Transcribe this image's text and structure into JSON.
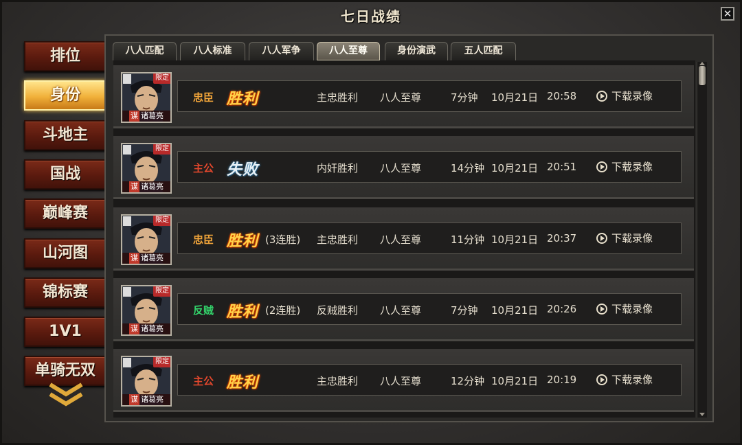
{
  "window": {
    "title": "七日战绩",
    "close_label": "✕"
  },
  "nav": {
    "items": [
      {
        "label": "排位"
      },
      {
        "label": "身份"
      },
      {
        "label": "斗地主"
      },
      {
        "label": "国战"
      },
      {
        "label": "巅峰赛"
      },
      {
        "label": "山河图"
      },
      {
        "label": "锦标赛"
      },
      {
        "label": "1V1"
      },
      {
        "label": "单骑无双"
      }
    ],
    "active_index": 1
  },
  "tabs": [
    {
      "label": "八人匹配"
    },
    {
      "label": "八人标准"
    },
    {
      "label": "八人军争"
    },
    {
      "label": "八人至尊"
    },
    {
      "label": "身份演武"
    },
    {
      "label": "五人匹配"
    }
  ],
  "active_tab_index": 3,
  "colors": {
    "loyal": "#f0a43a",
    "lord": "#e0472d",
    "rebel": "#33d26a"
  },
  "records": [
    {
      "avatar": {
        "badge": "限定",
        "tag": "谋",
        "name": "诸葛亮"
      },
      "role": "忠臣",
      "role_color": "#f0a43a",
      "result": "胜利",
      "result_type": "win",
      "streak": "",
      "outcome": "主忠胜利",
      "mode": "八人至尊",
      "duration": "7分钟",
      "date": "10月21日",
      "time": "20:58",
      "download": "下载录像"
    },
    {
      "avatar": {
        "badge": "限定",
        "tag": "谋",
        "name": "诸葛亮"
      },
      "role": "主公",
      "role_color": "#e0472d",
      "result": "失败",
      "result_type": "lose",
      "streak": "",
      "outcome": "内奸胜利",
      "mode": "八人至尊",
      "duration": "14分钟",
      "date": "10月21日",
      "time": "20:51",
      "download": "下载录像"
    },
    {
      "avatar": {
        "badge": "限定",
        "tag": "谋",
        "name": "诸葛亮"
      },
      "role": "忠臣",
      "role_color": "#f0a43a",
      "result": "胜利",
      "result_type": "win",
      "streak": "(3连胜)",
      "outcome": "主忠胜利",
      "mode": "八人至尊",
      "duration": "11分钟",
      "date": "10月21日",
      "time": "20:37",
      "download": "下载录像"
    },
    {
      "avatar": {
        "badge": "限定",
        "tag": "谋",
        "name": "诸葛亮"
      },
      "role": "反贼",
      "role_color": "#33d26a",
      "result": "胜利",
      "result_type": "win",
      "streak": "(2连胜)",
      "outcome": "反贼胜利",
      "mode": "八人至尊",
      "duration": "7分钟",
      "date": "10月21日",
      "time": "20:26",
      "download": "下载录像"
    },
    {
      "avatar": {
        "badge": "限定",
        "tag": "谋",
        "name": "诸葛亮"
      },
      "role": "主公",
      "role_color": "#e0472d",
      "result": "胜利",
      "result_type": "win",
      "streak": "",
      "outcome": "主忠胜利",
      "mode": "八人至尊",
      "duration": "12分钟",
      "date": "10月21日",
      "time": "20:19",
      "download": "下载录像"
    }
  ]
}
